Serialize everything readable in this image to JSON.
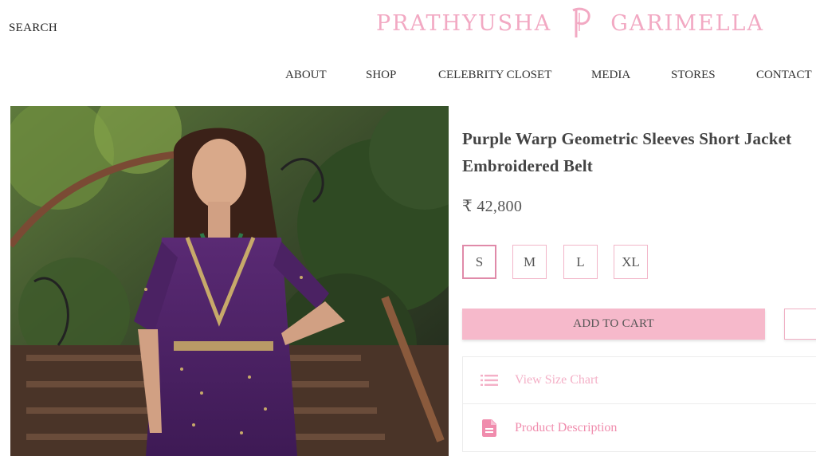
{
  "header": {
    "search_label": "SEARCH",
    "brand_first": "PRATHYUSHA",
    "brand_last": "GARIMELLA",
    "brand_monogram": "P",
    "brand_color": "#f2a9c3"
  },
  "nav": {
    "items": [
      {
        "label": "ABOUT"
      },
      {
        "label": "SHOP"
      },
      {
        "label": "CELEBRITY CLOSET"
      },
      {
        "label": "MEDIA"
      },
      {
        "label": "STORES"
      },
      {
        "label": "CONTACT"
      }
    ]
  },
  "product": {
    "title_line1": "Purple Warp Geometric Sleeves Short Jacket",
    "title_line2": "Embroidered Belt",
    "price": "₹ 42,800",
    "sizes": [
      "S",
      "M",
      "L",
      "XL"
    ],
    "selected_size": "S",
    "add_to_cart_label": "ADD TO CART",
    "accent_color": "#f6b9cb"
  },
  "accordion": {
    "items": [
      {
        "label": "View Size Chart",
        "icon": "list-icon"
      },
      {
        "label": "Product Description",
        "icon": "document-icon"
      }
    ]
  }
}
